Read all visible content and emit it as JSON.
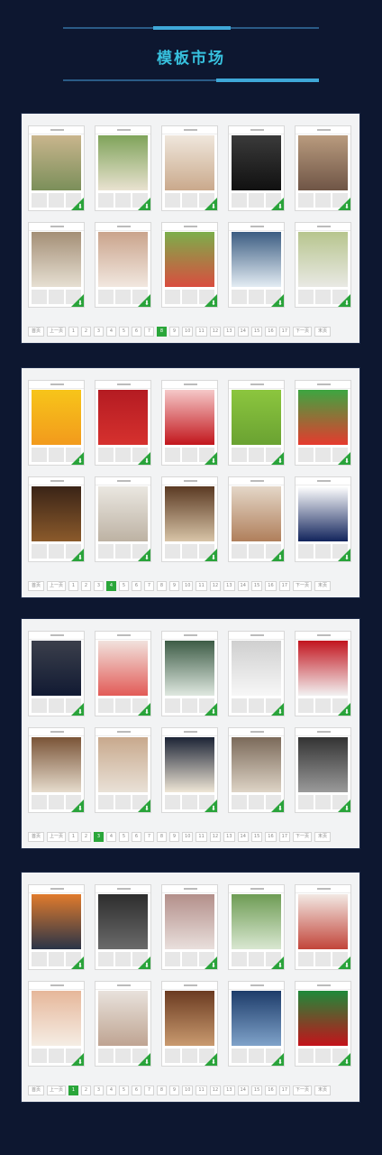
{
  "title": "模板市场",
  "colors": {
    "accent": "#37c1de",
    "active": "#2aa63a",
    "background": "#0d1730"
  },
  "icons": {
    "download": "download-icon"
  },
  "panels": [
    {
      "pager": {
        "first": "首页",
        "prev": "上一页",
        "pages": [
          "1",
          "2",
          "3",
          "4",
          "5",
          "6",
          "7",
          "8",
          "9",
          "10",
          "11",
          "12",
          "13",
          "14",
          "15",
          "16",
          "17"
        ],
        "active": "8",
        "next": "下一页",
        "last": "末页"
      },
      "cards": [
        {
          "colors": [
            "#c9b58d",
            "#7b8f5a"
          ]
        },
        {
          "colors": [
            "#7fa35a",
            "#e9e2d0"
          ]
        },
        {
          "colors": [
            "#efe7dc",
            "#caa98c"
          ]
        },
        {
          "colors": [
            "#3a3a3a",
            "#111111"
          ]
        },
        {
          "colors": [
            "#b99b7e",
            "#6f5546"
          ]
        },
        {
          "colors": [
            "#a48f76",
            "#e6dfd2"
          ]
        },
        {
          "colors": [
            "#caa48c",
            "#f1e7df"
          ]
        },
        {
          "colors": [
            "#7cae4b",
            "#d94d3f"
          ]
        },
        {
          "colors": [
            "#3c5d82",
            "#e3ecf3"
          ]
        },
        {
          "colors": [
            "#b7c58e",
            "#e9e9e4"
          ]
        }
      ]
    },
    {
      "pager": {
        "first": "首页",
        "prev": "上一页",
        "pages": [
          "1",
          "2",
          "3",
          "4",
          "5",
          "6",
          "7",
          "8",
          "9",
          "10",
          "11",
          "12",
          "13",
          "14",
          "15",
          "16",
          "17"
        ],
        "active": "4",
        "next": "下一页",
        "last": "末页"
      },
      "cards": [
        {
          "colors": [
            "#f7c51a",
            "#f29a1c"
          ]
        },
        {
          "colors": [
            "#b41b22",
            "#d6312e"
          ]
        },
        {
          "colors": [
            "#f5c8c8",
            "#c2161c"
          ]
        },
        {
          "colors": [
            "#8cc63e",
            "#6aa232"
          ]
        },
        {
          "colors": [
            "#3da641",
            "#e63a2e"
          ]
        },
        {
          "colors": [
            "#3a2417",
            "#8b5a2b"
          ]
        },
        {
          "colors": [
            "#eae7e1",
            "#bdb2a3"
          ]
        },
        {
          "colors": [
            "#5b3a23",
            "#d8c4a7"
          ]
        },
        {
          "colors": [
            "#e4d7c8",
            "#b07f5b"
          ]
        },
        {
          "colors": [
            "#ffffff",
            "#12245c"
          ]
        }
      ]
    },
    {
      "pager": {
        "first": "首页",
        "prev": "上一页",
        "pages": [
          "1",
          "2",
          "3",
          "4",
          "5",
          "6",
          "7",
          "8",
          "9",
          "10",
          "11",
          "12",
          "13",
          "14",
          "15",
          "16",
          "17"
        ],
        "active": "3",
        "next": "下一页",
        "last": "末页"
      },
      "cards": [
        {
          "colors": [
            "#3b3f4b",
            "#111a33"
          ]
        },
        {
          "colors": [
            "#f1e2dd",
            "#e25b57"
          ]
        },
        {
          "colors": [
            "#3d5c46",
            "#dfe8e0"
          ]
        },
        {
          "colors": [
            "#cfcfcf",
            "#f7f7f7"
          ]
        },
        {
          "colors": [
            "#c2141e",
            "#f2f2f2"
          ]
        },
        {
          "colors": [
            "#7a5437",
            "#e6dccd"
          ]
        },
        {
          "colors": [
            "#c8a98d",
            "#e9e1d7"
          ]
        },
        {
          "colors": [
            "#1c2436",
            "#efe6d6"
          ]
        },
        {
          "colors": [
            "#7b6a5a",
            "#ded4c6"
          ]
        },
        {
          "colors": [
            "#333333",
            "#9a9a9a"
          ]
        }
      ]
    },
    {
      "pager": {
        "first": "首页",
        "prev": "上一页",
        "pages": [
          "1",
          "2",
          "3",
          "4",
          "5",
          "6",
          "7",
          "8",
          "9",
          "10",
          "11",
          "12",
          "13",
          "14",
          "15",
          "16",
          "17"
        ],
        "active": "1",
        "next": "下一页",
        "last": "末页"
      },
      "cards": [
        {
          "colors": [
            "#e07b2c",
            "#2a3448"
          ]
        },
        {
          "colors": [
            "#2d2d2d",
            "#6a6a6a"
          ]
        },
        {
          "colors": [
            "#b38f8a",
            "#e9dfdc"
          ]
        },
        {
          "colors": [
            "#6e9c54",
            "#d9e7d1"
          ]
        },
        {
          "colors": [
            "#f2e8e3",
            "#c2453a"
          ]
        },
        {
          "colors": [
            "#e6b79a",
            "#f5ede4"
          ]
        },
        {
          "colors": [
            "#e8e2dc",
            "#bfa492"
          ]
        },
        {
          "colors": [
            "#6b3b21",
            "#c99a6f"
          ]
        },
        {
          "colors": [
            "#1d3c6a",
            "#7fa2c9"
          ]
        },
        {
          "colors": [
            "#1e8a3a",
            "#c4121a"
          ]
        }
      ]
    }
  ]
}
